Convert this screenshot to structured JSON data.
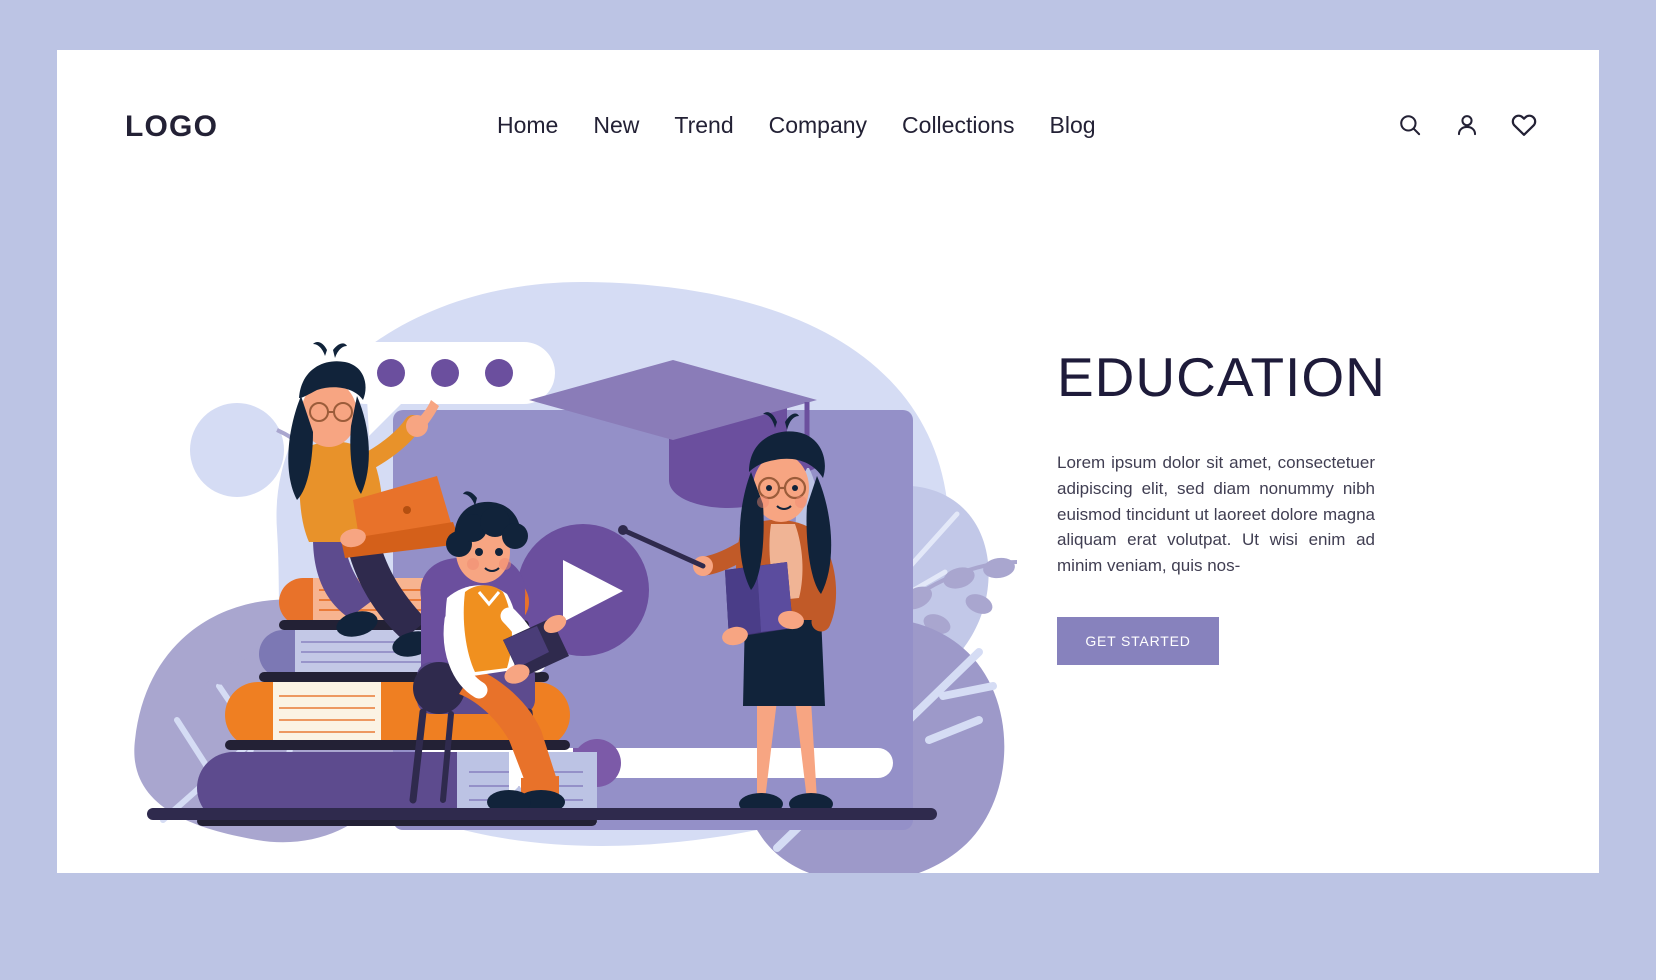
{
  "header": {
    "logo": "LOGO",
    "nav": [
      {
        "label": "Home"
      },
      {
        "label": "New"
      },
      {
        "label": "Trend"
      },
      {
        "label": "Company"
      },
      {
        "label": "Collections"
      },
      {
        "label": "Blog"
      }
    ],
    "icons": [
      {
        "name": "search-icon"
      },
      {
        "name": "user-icon"
      },
      {
        "name": "heart-icon"
      }
    ]
  },
  "hero": {
    "title": "EDUCATION",
    "paragraph": "Lorem ipsum dolor sit amet, consectetuer adipiscing elit, sed diam nonummy nibh euismod tincidunt ut laoreet dolore magna aliquam erat volutpat. Ut wisi enim ad minim veniam, quis nos-",
    "cta_label": "GET STARTED"
  },
  "illustration": {
    "alt": "education-illustration",
    "elements": [
      "video-player-card",
      "play-button",
      "progress-bar",
      "chat-bubble",
      "graduation-cap",
      "book-stack",
      "woman-with-laptop",
      "child-reading-in-chair",
      "teacher-with-pointer",
      "leaf-decoration",
      "circle-decoration",
      "ground-line"
    ]
  },
  "colors": {
    "page_border": "#bcc4e4",
    "canvas": "#ffffff",
    "text_dark": "#232135",
    "headline": "#1e1b3a",
    "accent_purple": "#6b4f9e",
    "accent_light_purple": "#8782bd",
    "player_body": "#9490c8",
    "bg_blob": "#d5dcf4",
    "leaf": "#a9a6cf",
    "orange": "#e8722a",
    "orange_light": "#f5a05e",
    "skin": "#f7a582",
    "hair_dark": "#11233a",
    "ground": "#2f2a4d"
  }
}
